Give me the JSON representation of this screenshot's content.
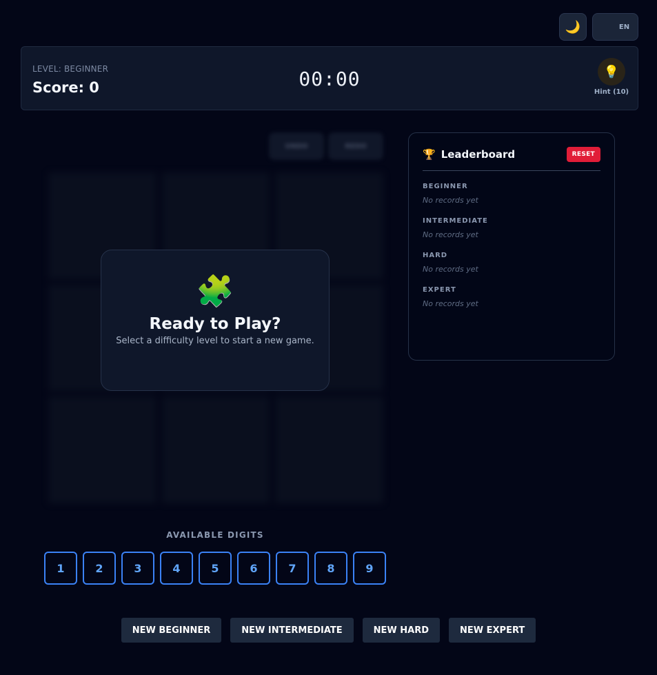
{
  "topbar": {
    "theme_icon": "🌙",
    "lang": "EN"
  },
  "header": {
    "level_label": "LEVEL: BEGINNER",
    "score": "Score: 0",
    "timer": "00:00",
    "hint_icon": "💡",
    "hint_label": "Hint (10)"
  },
  "board": {
    "undo_label": "UNDO",
    "redo_label": "REDO"
  },
  "overlay": {
    "icon": "🧩",
    "title": "Ready to Play?",
    "subtitle": "Select a difficulty level to start a new game."
  },
  "digits": {
    "title": "AVAILABLE DIGITS",
    "items": [
      "1",
      "2",
      "3",
      "4",
      "5",
      "6",
      "7",
      "8",
      "9"
    ]
  },
  "new_games": [
    "NEW BEGINNER",
    "NEW INTERMEDIATE",
    "NEW HARD",
    "NEW EXPERT"
  ],
  "leaderboard": {
    "icon": "🏆",
    "title": "Leaderboard",
    "reset_label": "RESET",
    "sections": [
      {
        "name": "BEGINNER",
        "empty": "No records yet"
      },
      {
        "name": "INTERMEDIATE",
        "empty": "No records yet"
      },
      {
        "name": "HARD",
        "empty": "No records yet"
      },
      {
        "name": "EXPERT",
        "empty": "No records yet"
      }
    ]
  },
  "colors": {
    "background": "#030617",
    "accent": "#3b82f6",
    "danger": "#e11d38"
  }
}
